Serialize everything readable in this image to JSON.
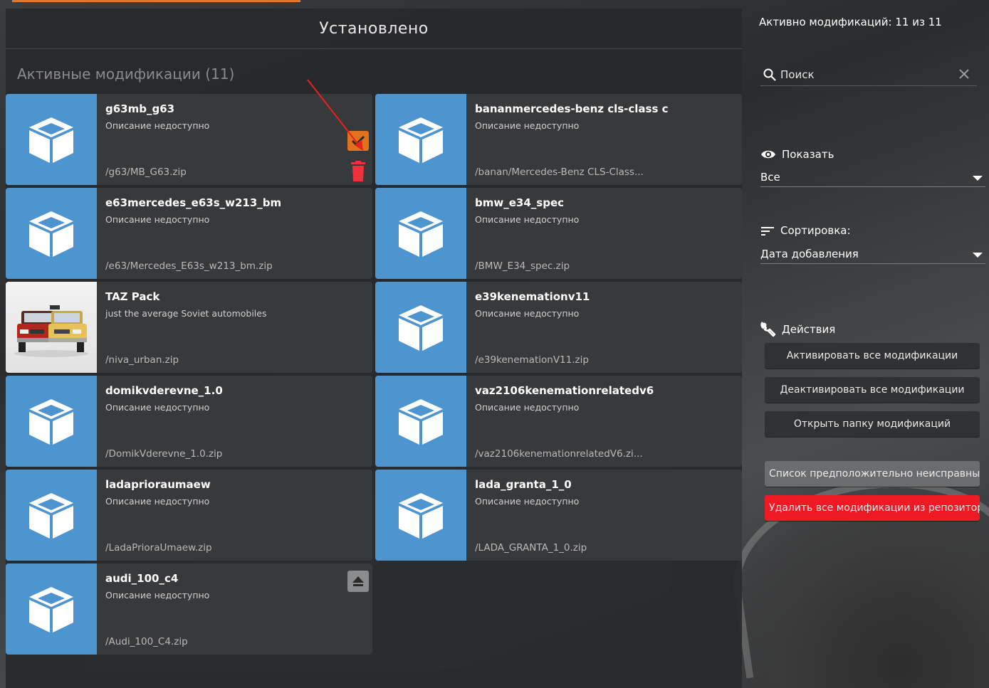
{
  "header": {
    "title": "Установлено"
  },
  "section": {
    "title": "Активные модификации (11)"
  },
  "mods": [
    {
      "name": "g63mb_g63",
      "desc": "Описание недоступно",
      "path": "/g63/MB_G63.zip",
      "thumb": "box-icon"
    },
    {
      "name": "bananmercedes-benz cls-class c",
      "desc": "Описание недоступно",
      "path": "/banan/Mercedes-Benz CLS-Class...",
      "thumb": "box-icon"
    },
    {
      "name": "e63mercedes_e63s_w213_bm",
      "desc": "Описание недоступно",
      "path": "/e63/Mercedes_E63s_w213_bm.zip",
      "thumb": "box-icon"
    },
    {
      "name": "bmw_e34_spec",
      "desc": "Описание недоступно",
      "path": "/BMW_E34_spec.zip",
      "thumb": "box-icon"
    },
    {
      "name": "TAZ Pack",
      "desc": "just the average Soviet automobiles",
      "path": "/niva_urban.zip",
      "thumb": "car-photo"
    },
    {
      "name": "e39kenemationv11",
      "desc": "Описание недоступно",
      "path": "/e39kenemationV11.zip",
      "thumb": "box-icon"
    },
    {
      "name": "domikvderevne_1.0",
      "desc": "Описание недоступно",
      "path": "/DomikVderevne_1.0.zip",
      "thumb": "box-icon"
    },
    {
      "name": "vaz2106kenemationrelatedv6",
      "desc": "Описание недоступно",
      "path": "/vaz2106kenemationrelatedV6.zi...",
      "thumb": "box-icon"
    },
    {
      "name": "ladaprioraumaew",
      "desc": "Описание недоступно",
      "path": "/LadaPrioraUmaew.zip",
      "thumb": "box-icon"
    },
    {
      "name": "lada_granta_1_0",
      "desc": "Описание недоступно",
      "path": "/LADA_GRANTA_1_0.zip",
      "thumb": "box-icon"
    },
    {
      "name": "audi_100_c4",
      "desc": "Описание недоступно",
      "path": "/Audi_100_C4.zip",
      "thumb": "box-icon"
    }
  ],
  "sidebar": {
    "active_count": "Активно модификаций: 11 из 11",
    "search_placeholder": "Поиск",
    "show_label": "Показать",
    "show_value": "Все",
    "sort_label": "Сортировка:",
    "sort_value": "Дата добавления",
    "actions_label": "Действия",
    "buttons": {
      "activate_all": "Активировать все модификации",
      "deactivate_all": "Деактивировать все модификации",
      "open_folder": "Открыть папку модификаций",
      "broken_list": "Список предположительно неисправных",
      "delete_all": "Удалить все модификации из репозитория"
    }
  },
  "colors": {
    "accent": "#e2731e",
    "thumb_blue": "#4e95cf",
    "danger": "#f01a25"
  }
}
